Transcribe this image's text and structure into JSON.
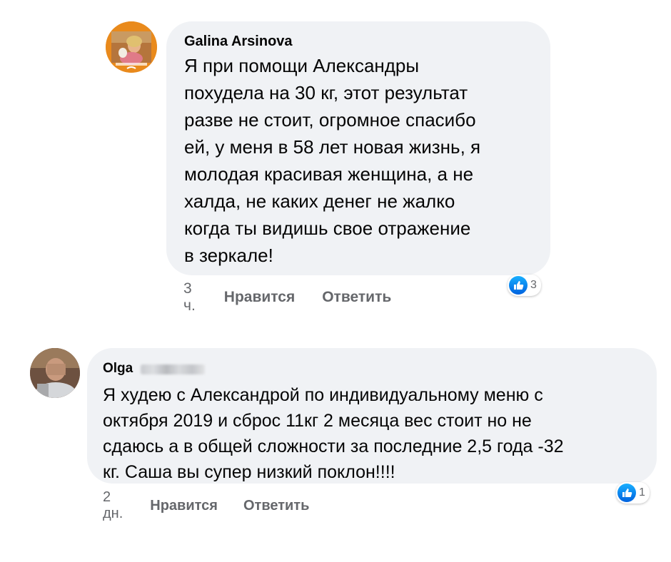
{
  "comments": [
    {
      "author": "Galina Arsinova",
      "text_lines": [
        "Я при помощи Александры",
        "похудела на 30 кг, этот результат",
        "разве не стоит, огромное спасибо",
        "ей, у меня в 58 лет новая жизнь, я",
        "молодая красивая женщина, а не",
        "халда, не каких денег не жалко",
        "когда ты видишь свое отражение",
        "в зеркале!"
      ],
      "time": "3 ч.",
      "like_label": "Нравится",
      "reply_label": "Ответить",
      "reaction_count": "3",
      "reaction_icon": "like-icon"
    },
    {
      "author": "Olga",
      "author_surname_blurred": true,
      "text_lines": [
        "Я худею с Александрой по индивидуальному меню с",
        "октября 2019 и сброс 11кг 2 месяца вес стоит но не",
        "сдаюсь а в общей сложности за последние 2,5 года -32",
        "кг. Саша вы супер низкий поклон!!!!"
      ],
      "time": "2 дн.",
      "like_label": "Нравится",
      "reply_label": "Ответить",
      "reaction_count": "1",
      "reaction_icon": "like-icon"
    }
  ],
  "colors": {
    "bubble_bg": "#f0f2f5",
    "meta_text": "#65676b",
    "like_blue": "#1877f2"
  }
}
